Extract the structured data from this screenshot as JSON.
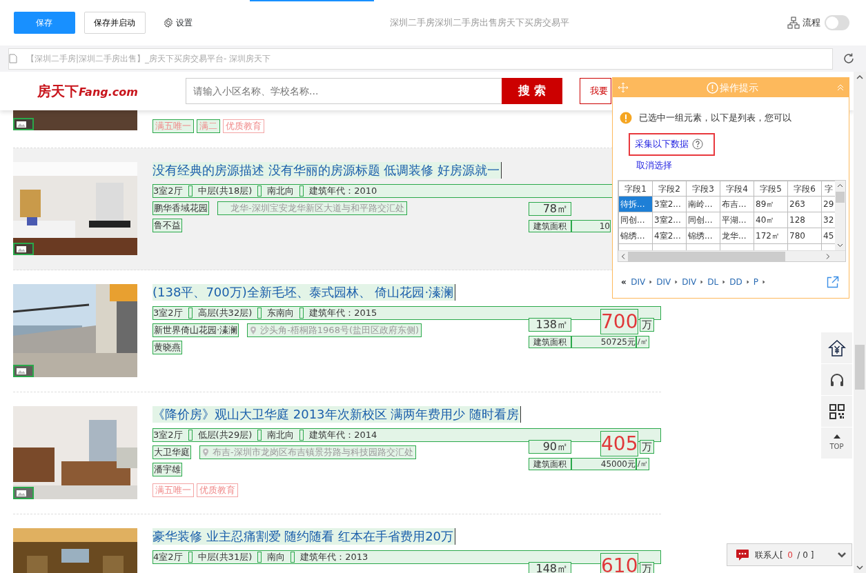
{
  "toolbar": {
    "save": "保存",
    "save_and_start": "保存并启动",
    "settings": "设置",
    "page_title": "深圳二手房深圳二手房出售房天下买房交易平",
    "flow": "流程",
    "flow_on": false
  },
  "address_bar": {
    "url": "【深圳二手房|深圳二手房出售】_房天下买房交易平台- 深圳房天下"
  },
  "site_header": {
    "logo_cn": "房天下",
    "logo_en": "Fang.com",
    "search_placeholder": "请输入小区名称、学校名称...",
    "search_button": "搜 索",
    "sell_button": "我要"
  },
  "listings": [
    {
      "hovered": false,
      "tags": [
        {
          "label": "满五唯一",
          "highlighted": true
        },
        {
          "label": "满二",
          "highlighted": true
        },
        {
          "label": "优质教育",
          "highlighted": false
        }
      ]
    },
    {
      "hovered": true,
      "title": "没有经典的房源描述 没有华丽的房源标题 低调装修 好房源就一",
      "attributes": [
        "3室2厅",
        "中层(共18层)",
        "南北向",
        "建筑年代：2010"
      ],
      "community": "鹏华香域花园",
      "address": "龙华-深圳宝安龙华新区大道与和平路交汇处",
      "pin": false,
      "agent": "鲁不益",
      "area": "78㎡",
      "area_label": "建筑面积",
      "unit_price": "10"
    },
    {
      "hovered": false,
      "title": "(138平、700万)全新毛坯、泰式园林、 倚山花园·溱澜",
      "attributes": [
        "3室2厅",
        "高层(共32层)",
        "东南向",
        "建筑年代：2015"
      ],
      "community": "新世界倚山花园·溱澜",
      "address": "沙头角-梧桐路1968号(盐田区政府东侧)",
      "pin": true,
      "agent": "黄晓燕",
      "area": "138㎡",
      "area_label": "建筑面积",
      "total_price": "700",
      "price_unit": "万",
      "unit_price": "50725元",
      "unit_suffix": "/㎡"
    },
    {
      "hovered": false,
      "title": "《降价房》观山大卫华庭 2013年次新校区 满两年费用少 随时看房",
      "attributes": [
        "3室2厅",
        "低层(共29层)",
        "南北向",
        "建筑年代：2014"
      ],
      "community": "大卫华庭",
      "address": "布吉-深圳市龙岗区布吉镇景芬路与科技园路交汇处",
      "pin": true,
      "agent": "潘宇雄",
      "area": "90㎡",
      "area_label": "建筑面积",
      "total_price": "405",
      "price_unit": "万",
      "unit_price": "45000元",
      "unit_suffix": "/㎡",
      "tags": [
        {
          "label": "满五唯一",
          "highlighted": false
        },
        {
          "label": "优质教育",
          "highlighted": false
        }
      ]
    },
    {
      "hovered": false,
      "title": "豪华装修 业主忍痛割爱 随约随看 红本在手省费用20万",
      "attributes": [
        "4室2厅",
        "中层(共31层)",
        "南向",
        "建筑年代：2013"
      ],
      "area": "148㎡",
      "total_price": "610",
      "price_unit": "万"
    }
  ],
  "tip_panel": {
    "title": "操作提示",
    "message": "已选中一组元素，以下是列表，您可以",
    "collect_link": "采集以下数据",
    "cancel_link": "取消选择",
    "table": {
      "columns": [
        "字段1",
        "字段2",
        "字段3",
        "字段4",
        "字段5",
        "字段6",
        "字"
      ],
      "rows": [
        {
          "cells": [
            {
              "text": "待拆...",
              "selected": true
            },
            {
              "text": "3室2...",
              "selected": false
            },
            {
              "text": "南岭...",
              "selected": false
            },
            {
              "text": "布吉...",
              "selected": false
            },
            {
              "text": "89㎡",
              "selected": false
            },
            {
              "text": "263",
              "selected": false
            },
            {
              "text": "29",
              "selected": false
            }
          ]
        },
        {
          "cells": [
            {
              "text": "同创...",
              "selected": false
            },
            {
              "text": "3室2...",
              "selected": false
            },
            {
              "text": "同创...",
              "selected": false
            },
            {
              "text": "平湖...",
              "selected": false
            },
            {
              "text": "40㎡",
              "selected": false
            },
            {
              "text": "128",
              "selected": false
            },
            {
              "text": "32",
              "selected": false
            }
          ]
        },
        {
          "cells": [
            {
              "text": "锦绣...",
              "selected": false
            },
            {
              "text": "4室2...",
              "selected": false
            },
            {
              "text": "锦绣...",
              "selected": false
            },
            {
              "text": "龙华...",
              "selected": false
            },
            {
              "text": "172㎡",
              "selected": false
            },
            {
              "text": "780",
              "selected": false
            },
            {
              "text": "45",
              "selected": false
            }
          ]
        }
      ]
    },
    "breadcrumb_back": "«",
    "breadcrumb": [
      "DIV",
      "DIV",
      "DIV",
      "DL",
      "DD",
      "P"
    ]
  },
  "side_tools": [
    {
      "kind": "home-price"
    },
    {
      "kind": "service"
    },
    {
      "kind": "qr"
    },
    {
      "kind": "top",
      "label": "TOP"
    }
  ],
  "contact_bar": {
    "label": "联系人[",
    "online": "0",
    "rest": "/ 0 ]"
  }
}
